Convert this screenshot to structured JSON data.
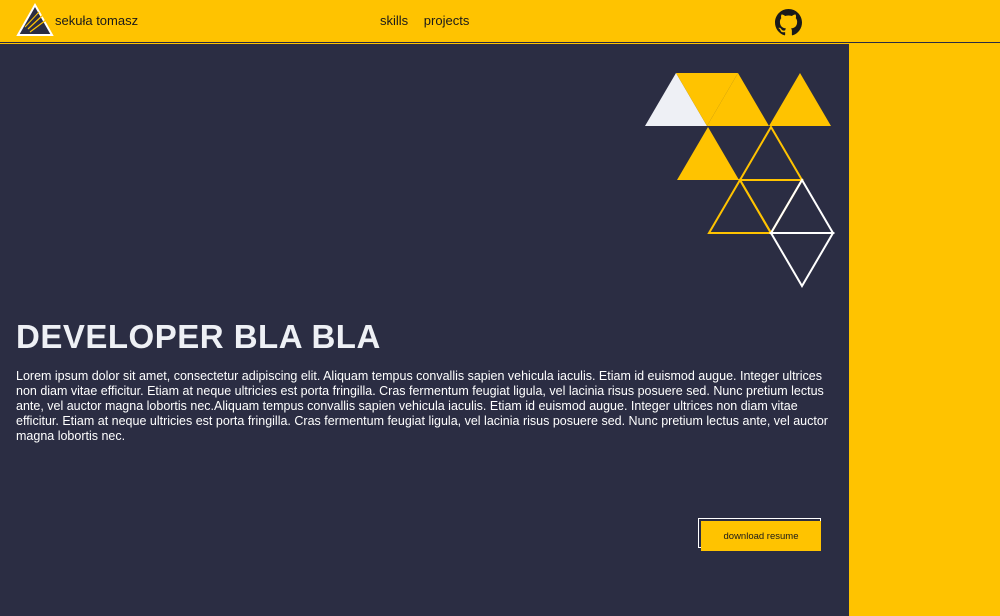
{
  "colors": {
    "accent": "#FFC300",
    "background": "#2b2d43",
    "text": "#ffffff",
    "triangle_light": "#eef0f5"
  },
  "header": {
    "brand": "sekuła tomasz",
    "nav": [
      {
        "label": "skills"
      },
      {
        "label": "projects"
      }
    ],
    "github_icon": "github-icon"
  },
  "hero": {
    "title": "DEVELOPER BLA BLA",
    "text": "Lorem ipsum dolor sit amet, consectetur adipiscing elit. Aliquam tempus convallis sapien vehicula iaculis. Etiam id euismod augue. Integer ultrices non diam vitae efficitur. Etiam at neque ultricies est porta fringilla. Cras fermentum feugiat ligula, vel lacinia risus posuere sed. Nunc pretium lectus ante, vel auctor magna lobortis nec.Aliquam tempus convallis sapien vehicula iaculis. Etiam id euismod augue. Integer ultrices non diam vitae efficitur. Etiam at neque ultricies est porta fringilla. Cras fermentum feugiat ligula, vel lacinia risus posuere sed. Nunc pretium lectus ante, vel auctor magna lobortis nec.",
    "resume_button": "download resume"
  }
}
